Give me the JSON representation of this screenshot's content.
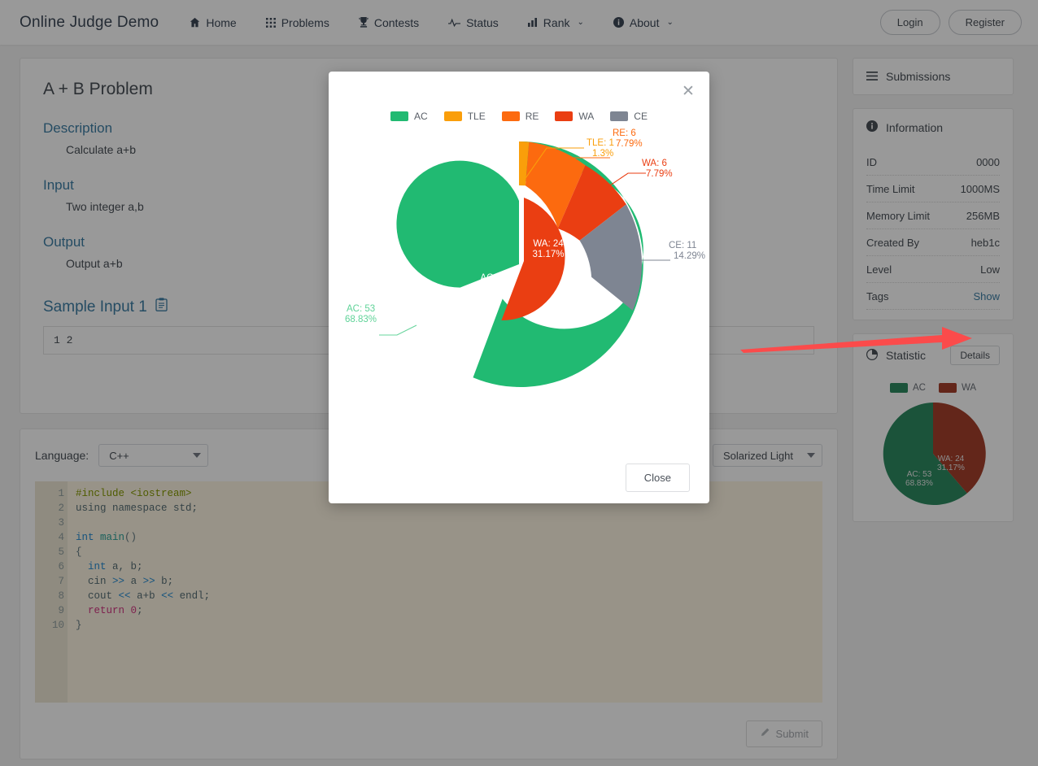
{
  "navbar": {
    "brand": "Online Judge Demo",
    "items": [
      {
        "label": "Home",
        "icon": "home-icon",
        "caret": false
      },
      {
        "label": "Problems",
        "icon": "grid-icon",
        "caret": false
      },
      {
        "label": "Contests",
        "icon": "trophy-icon",
        "caret": false
      },
      {
        "label": "Status",
        "icon": "pulse-icon",
        "caret": false
      },
      {
        "label": "Rank",
        "icon": "bar-chart-icon",
        "caret": true
      },
      {
        "label": "About",
        "icon": "info-icon",
        "caret": true
      }
    ],
    "login": "Login",
    "register": "Register",
    "caret_glyph": "⌄"
  },
  "problem": {
    "title": "A + B Problem",
    "sections": [
      {
        "head": "Description",
        "body": "Calculate a+b"
      },
      {
        "head": "Input",
        "body": "Two integer a,b"
      },
      {
        "head": "Output",
        "body": "Output a+b"
      }
    ],
    "sample_head": "Sample Input 1",
    "sample_copy_icon": "clipboard-icon",
    "sample_value": "1 2"
  },
  "editor": {
    "language_label": "Language:",
    "language_value": "C++",
    "theme_value": "Solarized Light",
    "submit_label": "Submit",
    "submit_icon": "pencil-icon",
    "line_numbers": [
      "1",
      "2",
      "3",
      "4",
      "5",
      "6",
      "7",
      "8",
      "9",
      "10"
    ],
    "fold_lines": [
      "1",
      "5"
    ],
    "code": [
      "#include <iostream>",
      "using namespace std;",
      "",
      "int main()",
      "{",
      "  int a, b;",
      "  cin >> a >> b;",
      "  cout << a+b << endl;",
      "  return 0;",
      "}"
    ]
  },
  "sidebar": {
    "submissions": {
      "label": "Submissions",
      "icon": "list-icon"
    },
    "information": {
      "label": "Information",
      "icon": "info-circle-icon",
      "rows": [
        {
          "key": "ID",
          "value": "0000",
          "link": false
        },
        {
          "key": "Time Limit",
          "value": "1000MS",
          "link": false
        },
        {
          "key": "Memory Limit",
          "value": "256MB",
          "link": false
        },
        {
          "key": "Created By",
          "value": "heb1c",
          "link": false
        },
        {
          "key": "Level",
          "value": "Low",
          "link": false
        },
        {
          "key": "Tags",
          "value": "Show",
          "link": true
        }
      ]
    },
    "statistic": {
      "label": "Statistic",
      "icon": "pie-chart-icon",
      "details_label": "Details"
    }
  },
  "modal": {
    "close_icon": "close-icon",
    "close_label": "Close",
    "legend": [
      {
        "label": "AC",
        "color": "#21ba72"
      },
      {
        "label": "TLE",
        "color": "#fa9e0a"
      },
      {
        "label": "RE",
        "color": "#fc6a0f"
      },
      {
        "label": "WA",
        "color": "#ea3e12"
      },
      {
        "label": "CE",
        "color": "#7e8592"
      }
    ]
  },
  "annotation": {
    "arrow_color": "#fb4b4b",
    "points_at": "details-button"
  },
  "chart_data": [
    {
      "type": "pie",
      "name": "modal-outer-ring",
      "title": "",
      "donut": true,
      "categories": [
        "AC",
        "TLE",
        "RE",
        "WA",
        "CE"
      ],
      "values": [
        53,
        1,
        6,
        6,
        11
      ],
      "percents": [
        "68.83%",
        "1.3%",
        "7.79%",
        "7.79%",
        "14.29%"
      ],
      "colors": [
        "#21ba72",
        "#fa9e0a",
        "#fc6a0f",
        "#ea3e12",
        "#7e8592"
      ],
      "labels": [
        "AC: 53",
        "TLE: 1",
        "RE: 6",
        "WA: 6",
        "CE: 11"
      ],
      "legend_position": "top"
    },
    {
      "type": "pie",
      "name": "modal-inner-ring",
      "title": "",
      "donut": false,
      "categories": [
        "AC",
        "WA"
      ],
      "values": [
        53,
        24
      ],
      "percents": [
        "68.83%",
        "31.17%"
      ],
      "colors": [
        "#21ba72",
        "#ea3e12"
      ],
      "labels": [
        "AC: 53",
        "WA: 24"
      ],
      "legend_position": "none"
    },
    {
      "type": "pie",
      "name": "sidebar-statistic-pie",
      "title": "",
      "donut": false,
      "categories": [
        "AC",
        "WA"
      ],
      "values": [
        53,
        24
      ],
      "percents": [
        "68.83%",
        "31.17%"
      ],
      "colors": [
        "#2e8b62",
        "#a6402c"
      ],
      "labels": [
        "AC: 53",
        "WA: 24"
      ],
      "legend_position": "top"
    }
  ]
}
